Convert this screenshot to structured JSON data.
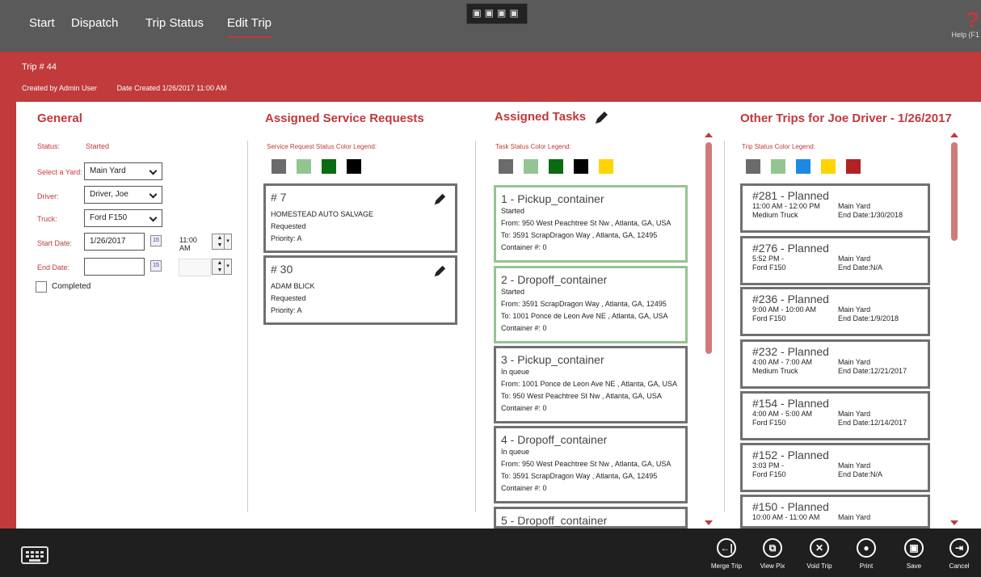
{
  "nav": {
    "start": "Start",
    "dispatch": "Dispatch",
    "trip_status": "Trip Status",
    "edit_trip": "Edit Trip"
  },
  "help": {
    "label": "Help (F1"
  },
  "header": {
    "trip": "Trip # 44",
    "created_by": "Created by Admin User",
    "date_created": "Date Created 1/26/2017 11:00 AM"
  },
  "general": {
    "title": "General",
    "status_label": "Status:",
    "status_value": "Started",
    "yard_label": "Select a Yard:",
    "yard_value": "Main Yard",
    "driver_label": "Driver:",
    "driver_value": "Driver, Joe",
    "truck_label": "Truck:",
    "truck_value": "Ford F150",
    "start_label": "Start Date:",
    "start_date": "1/26/2017",
    "start_time": "11:00 AM",
    "end_label": "End Date:",
    "end_date": "",
    "end_time": "",
    "completed_label": "Completed",
    "cal_icon": "15"
  },
  "service": {
    "title": "Assigned Service Requests",
    "legend": "Service Request Status Color Legend:",
    "legend_colors": [
      "#6b6b6b",
      "#93c593",
      "#0a6b12",
      "#000000"
    ],
    "cards": [
      {
        "num": "# 7",
        "name": "HOMESTEAD AUTO SALVAGE",
        "status": "Requested",
        "priority": "Priority: A"
      },
      {
        "num": "# 30",
        "name": "ADAM BLICK",
        "status": "Requested",
        "priority": "Priority: A"
      }
    ]
  },
  "tasks": {
    "title": "Assigned Tasks",
    "legend": "Task Status Color Legend:",
    "legend_colors": [
      "#6b6b6b",
      "#93c593",
      "#0a6b12",
      "#000000",
      "#ffd400"
    ],
    "cards": [
      {
        "title": "1  -  Pickup_container",
        "status": "Started",
        "from": "From: 950 West Peachtree St Nw , Atlanta, GA, USA",
        "to": "To: 3591 ScrapDragon Way , Atlanta, GA, 12495",
        "container": "Container #: 0"
      },
      {
        "title": "2  -  Dropoff_container",
        "status": "Started",
        "from": "From: 3591 ScrapDragon Way , Atlanta, GA, 12495",
        "to": "To: 1001 Ponce de Leon Ave NE , Atlanta, GA, USA",
        "container": "Container #: 0"
      },
      {
        "title": "3  -  Pickup_container",
        "status": "In queue",
        "from": "From: 1001 Ponce de Leon Ave NE , Atlanta, GA, USA",
        "to": "To: 950 West Peachtree St Nw , Atlanta, GA, USA",
        "container": "Container #: 0"
      },
      {
        "title": "4  -  Dropoff_container",
        "status": "In queue",
        "from": "From: 950 West Peachtree St Nw , Atlanta, GA, USA",
        "to": "To: 3591 ScrapDragon Way , Atlanta, GA, 12495",
        "container": "Container #: 0"
      },
      {
        "title": "5  -  Dropoff_container"
      }
    ]
  },
  "other": {
    "title": "Other Trips for Joe Driver - 1/26/2017",
    "legend": "Trip Status Color Legend:",
    "legend_colors": [
      "#6b6b6b",
      "#93c593",
      "#1e88e5",
      "#ffd400",
      "#b22222"
    ],
    "trips": [
      {
        "num": "#281 - Planned",
        "time": "11:00 AM - 12:00 PM",
        "yard": "Main Yard",
        "truck": "Medium Truck",
        "end": "End Date:1/30/2018"
      },
      {
        "num": "#276 - Planned",
        "time": "5:52 PM -",
        "yard": "Main Yard",
        "truck": "Ford F150",
        "end": "End Date:N/A"
      },
      {
        "num": "#236 - Planned",
        "time": "9:00 AM - 10:00 AM",
        "yard": "Main Yard",
        "truck": "Ford F150",
        "end": "End Date:1/9/2018"
      },
      {
        "num": "#232 - Planned",
        "time": "4:00 AM - 7:00 AM",
        "yard": "Main Yard",
        "truck": "Medium Truck",
        "end": "End Date:12/21/2017"
      },
      {
        "num": "#154 - Planned",
        "time": "4:00 AM - 5:00 AM",
        "yard": "Main Yard",
        "truck": "Ford F150",
        "end": "End Date:12/14/2017"
      },
      {
        "num": "#152 - Planned",
        "time": "3:03 PM -",
        "yard": "Main Yard",
        "truck": "Ford F150",
        "end": "End Date:N/A"
      },
      {
        "num": "#150 - Planned",
        "time": "10:00 AM - 11:00 AM",
        "yard": "Main Yard",
        "truck": "",
        "end": ""
      }
    ]
  },
  "actions": {
    "merge": "Merge Trip",
    "view": "View Pix",
    "void": "Void Trip",
    "print": "Print",
    "save": "Save",
    "cancel": "Cancel",
    "merge_icon": "←|",
    "view_icon": "⧉",
    "void_icon": "✕",
    "print_icon": "●",
    "save_icon": "▣",
    "cancel_icon": "⇥"
  },
  "snap_icons": "▣▣▣▣"
}
